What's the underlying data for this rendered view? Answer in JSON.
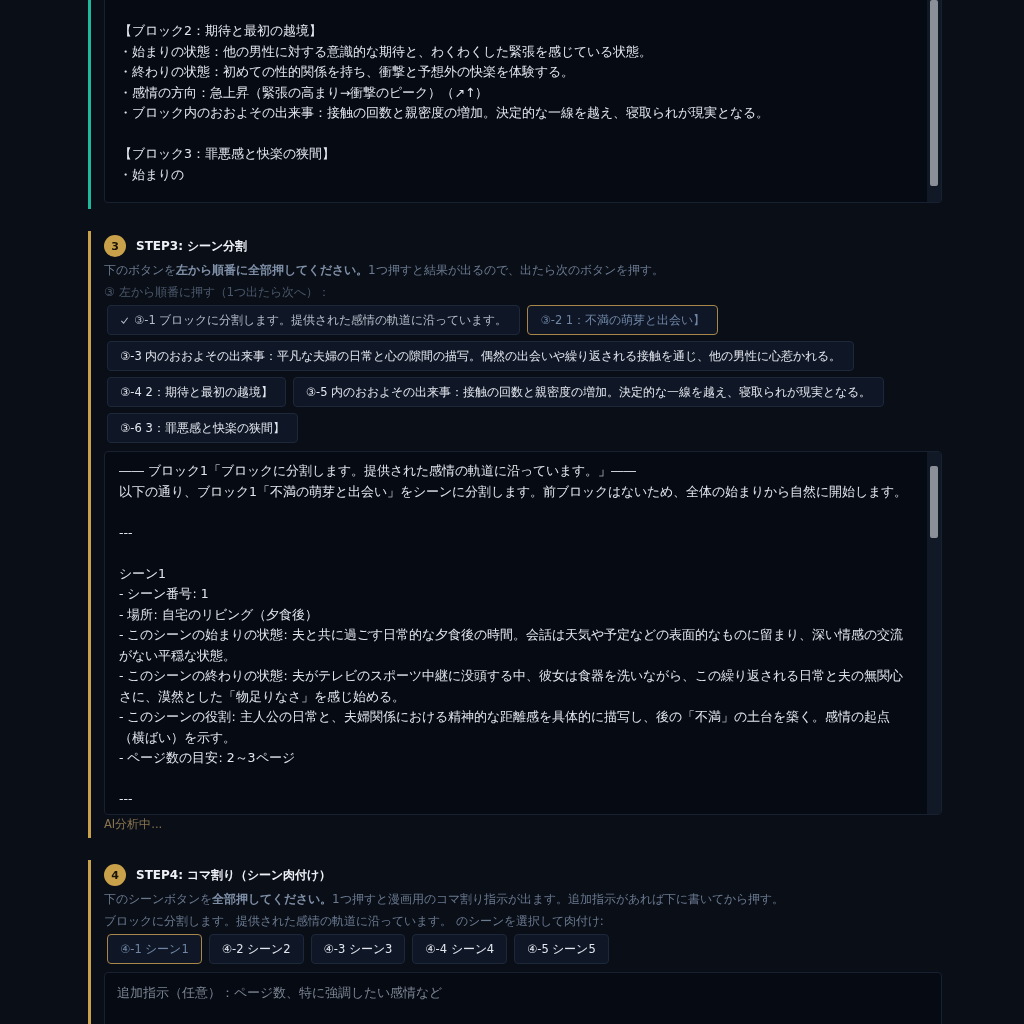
{
  "sections": [
    {
      "done": true,
      "output": {
        "paragraphs": [
          [
            "【ブロック2：期待と最初の越境】",
            "・始まりの状態：他の男性に対する意識的な期待と、わくわくした緊張を感じている状態。",
            "・終わりの状態：初めての性的関係を持ち、衝撃と予想外の快楽を体験する。",
            "・感情の方向：急上昇（緊張の高まり→衝撃のピーク）（↗↑）",
            "・ブロック内のおおよその出来事：接触の回数と親密度の増加。決定的な一線を越え、寝取られが現実となる。"
          ],
          [
            "【ブロック3：罪悪感と快楽の狭間】",
            "・始まりの"
          ]
        ]
      }
    },
    {
      "done": false,
      "number": "3",
      "title": "STEP3: シーン分割",
      "instruction": "下のボタンを**左から順番に全部押してください。**1つ押すと結果が出るので、出たら次のボタンを押す。",
      "hint": "③ 左から順番に押す（1つ出たら次へ）：",
      "buttons": [
        {
          "label": "③-1 ブロックに分割します。提供された感情の軌道に沿っています。",
          "done": true,
          "selected": false
        },
        {
          "label": "③-2 1：不満の萌芽と出会い】",
          "done": false,
          "selected": true
        },
        {
          "label": "③-3 内のおおよその出来事：平凡な夫婦の日常と心の隙間の描写。偶然の出会いや繰り返される接触を通じ、他の男性に心惹かれる。",
          "done": false,
          "selected": false
        },
        {
          "label": "③-4 2：期待と最初の越境】",
          "done": false,
          "selected": false
        },
        {
          "label": "③-5 内のおおよその出来事：接触の回数と親密度の増加。決定的な一線を越え、寝取られが現実となる。",
          "done": false,
          "selected": false
        },
        {
          "label": "③-6 3：罪悪感と快楽の狭間】",
          "done": false,
          "selected": false
        }
      ],
      "output": {
        "paragraphs": [
          [
            "―― ブロック1「ブロックに分割します。提供された感情の軌道に沿っています。」――",
            "以下の通り、ブロック1「不満の萌芽と出会い」をシーンに分割します。前ブロックはないため、全体の始まりから自然に開始します。"
          ],
          [
            "---"
          ],
          [
            "シーン1",
            "- シーン番号: 1",
            "- 場所: 自宅のリビング（夕食後）",
            "- このシーンの始まりの状態: 夫と共に過ごす日常的な夕食後の時間。会話は天気や予定などの表面的なものに留まり、深い情感の交流がない平穏な状態。",
            "- このシーンの終わりの状態: 夫がテレビのスポーツ中継に没頭する中、彼女は食器を洗いながら、この繰り返される日常と夫の無関心さに、漠然とした「物足りなさ」を感じ始める。",
            "- このシーンの役割: 主人公の日常と、夫婦関係における精神的な距離感を具体的に描写し、後の「不満」の土台を築く。感情の起点（横ばい）を示す。",
            "- ページ数の目安: 2～3ページ"
          ],
          [
            "---"
          ]
        ]
      },
      "progress": "AI分析中..."
    },
    {
      "done": false,
      "number": "4",
      "title": "STEP4: コマ割り（シーン肉付け）",
      "instruction": "下のシーンボタンを**全部押してください。**1つ押すと漫画用のコマ割り指示が出ます。追加指示があれば下に書いてから押す。",
      "hint": "ブロックに分割します。提供された感情の軌道に沿っています。 のシーンを選択して肉付け:",
      "buttons": [
        {
          "label": "④-1 シーン1",
          "done": false,
          "selected": true
        },
        {
          "label": "④-2 シーン2",
          "done": false,
          "selected": false
        },
        {
          "label": "④-3 シーン3",
          "done": false,
          "selected": false
        },
        {
          "label": "④-4 シーン4",
          "done": false,
          "selected": false
        },
        {
          "label": "④-5 シーン5",
          "done": false,
          "selected": false
        }
      ],
      "input": {
        "placeholder": "追加指示（任意）：ページ数、特に強調したい感情など"
      }
    }
  ]
}
